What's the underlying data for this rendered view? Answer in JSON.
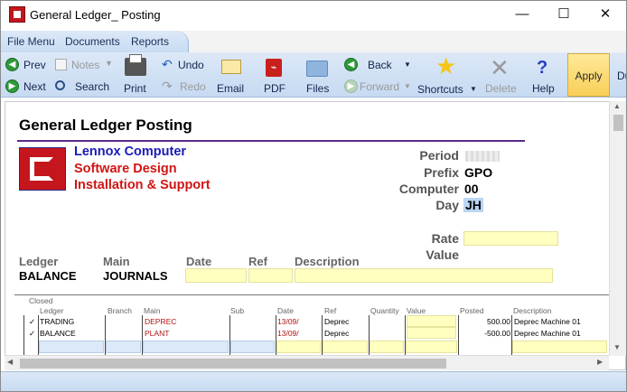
{
  "window": {
    "title": "General Ledger_ Posting",
    "minimize": "—",
    "maximize": "☐",
    "close": "✕"
  },
  "menu": {
    "items": [
      "File Menu",
      "Documents",
      "Reports"
    ]
  },
  "toolbar": {
    "prev": "Prev",
    "next": "Next",
    "notes": "Notes",
    "search": "Search",
    "print": "Print",
    "undo": "Undo",
    "redo": "Redo",
    "email": "Email",
    "pdf": "PDF",
    "files": "Files",
    "back": "Back",
    "forward": "Forward",
    "shortcuts": "Shortcuts",
    "delete": "Delete",
    "help": "Help",
    "apply": "Apply",
    "overflow": "Du"
  },
  "page": {
    "title": "General Ledger Posting",
    "company": {
      "line1": "Lennox Computer",
      "line2": "Software Design",
      "line3": "Installation & Support"
    },
    "colors": {
      "line1": "#1a1ab8",
      "line2": "#d11414",
      "line3": "#d11414",
      "rule": "#5b2a86"
    },
    "period_label": "Period",
    "prefix_label": "Prefix",
    "prefix_value": "GPO",
    "computer_label": "Computer",
    "computer_value": "00",
    "day_label": "Day",
    "day_value": "JH",
    "rate_label": "Rate",
    "value_label": "Value",
    "fields": {
      "ledger_label": "Ledger",
      "ledger_value": "BALANCE",
      "main_label": "Main",
      "main_value": "JOURNALS",
      "date_label": "Date",
      "ref_label": "Ref",
      "description_label": "Description"
    }
  },
  "grid": {
    "closed_label": "Closed",
    "headers": [
      "Ledger",
      "Branch",
      "Main",
      "Sub",
      "Date",
      "Ref",
      "Quantity",
      "Value",
      "Posted",
      "Description"
    ],
    "rows": [
      {
        "check": "✓",
        "ledger": "TRADING",
        "main": "DEPREC",
        "date": "13/09/",
        "ref": "Deprec",
        "posted": "500.00",
        "description": "Deprec Machine 01"
      },
      {
        "check": "✓",
        "ledger": "BALANCE",
        "main": "PLANT",
        "date": "13/09/",
        "ref": "Deprec",
        "posted": "-500.00",
        "description": "Deprec Machine 01"
      }
    ]
  }
}
